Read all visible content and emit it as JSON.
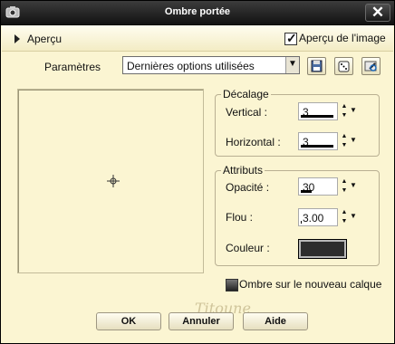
{
  "window": {
    "title": "Ombre portée"
  },
  "topbar": {
    "preview_toggle_label": "Aperçu",
    "image_preview_label": "Aperçu de l'image",
    "image_preview_checked": true
  },
  "presets": {
    "label": "Paramètres",
    "value": "Dernières options utilisées"
  },
  "offset": {
    "title": "Décalage",
    "vertical_label": "Vertical :",
    "vertical_value": "3",
    "horizontal_label": "Horizontal :",
    "horizontal_value": "3"
  },
  "attributes": {
    "title": "Attributs",
    "opacity_label": "Opacité :",
    "opacity_value": "30",
    "blur_label": "Flou :",
    "blur_value": "3.00",
    "color_label": "Couleur :",
    "color_value": "#2d2d2d"
  },
  "new_layer": {
    "label": "Ombre sur le nouveau calque",
    "checked": false
  },
  "buttons": {
    "ok": "OK",
    "cancel": "Annuler",
    "help": "Aide"
  },
  "watermark": "Titoune",
  "colors": {
    "background": "#fbf5d2",
    "titlebar": "#1a1a1a",
    "title_text": "#ffffff"
  }
}
